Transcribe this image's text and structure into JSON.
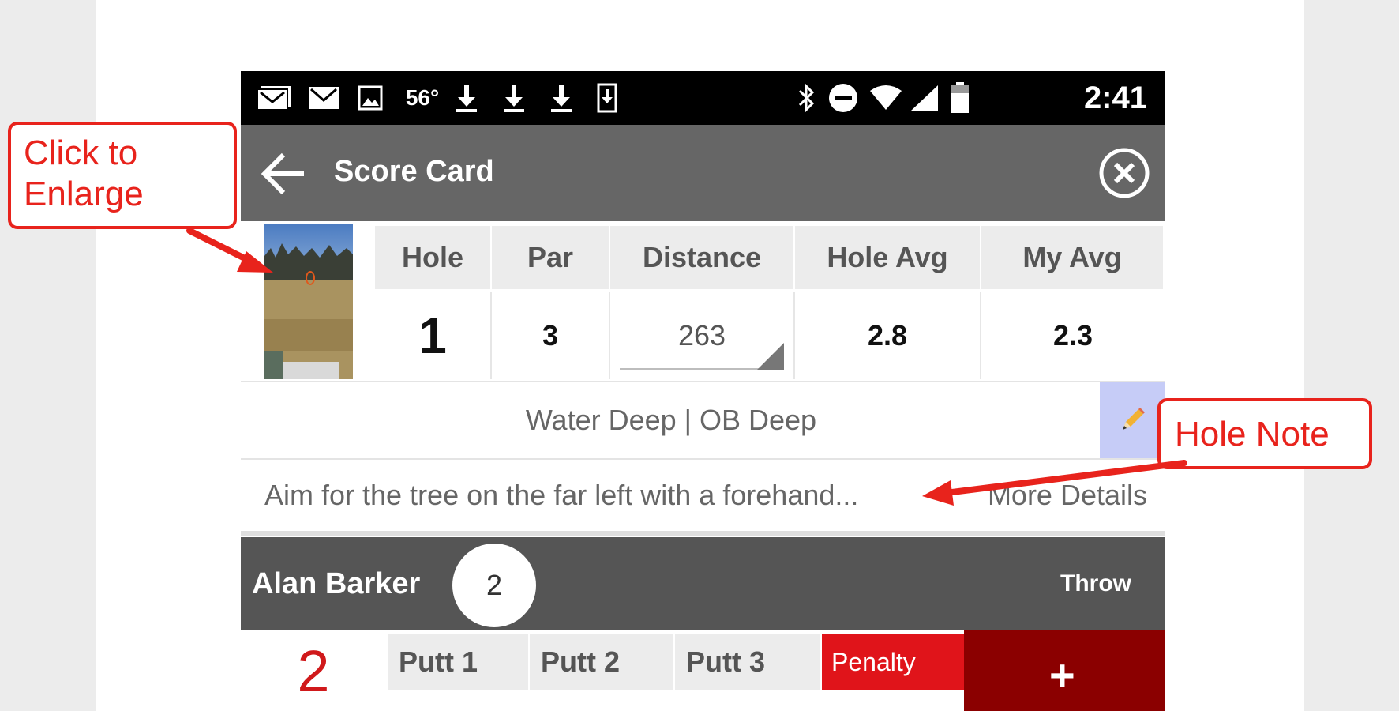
{
  "status_bar": {
    "temperature": "56°",
    "time": "2:41",
    "left_icons": [
      "gmail-multi-icon",
      "gmail-icon",
      "image-icon",
      "temperature",
      "download-icon",
      "download-icon",
      "download-icon",
      "phone-download-icon"
    ],
    "right_icons": [
      "bluetooth-icon",
      "do-not-disturb-icon",
      "wifi-icon",
      "cell-signal-icon",
      "battery-icon"
    ]
  },
  "app_bar": {
    "title": "Score Card"
  },
  "hole_table": {
    "headers": [
      "Hole",
      "Par",
      "Distance",
      "Hole Avg",
      "My Avg"
    ],
    "values": {
      "hole": "1",
      "par": "3",
      "distance": "263",
      "hole_avg": "2.8",
      "my_avg": "2.3"
    }
  },
  "hazards": "Water Deep | OB Deep",
  "note": {
    "text": "Aim for the tree on the far left with a forehand...",
    "more_label": "More Details"
  },
  "player": {
    "name": "Alan Barker",
    "score": "2",
    "throw_label": "Throw"
  },
  "strokes": {
    "big_score": "2",
    "putts": [
      "Putt 1",
      "Putt 2",
      "Putt 3"
    ],
    "penalty_label": "Penalty",
    "add_label": "+"
  },
  "annotations": {
    "enlarge": "Click to Enlarge",
    "hole_note": "Hole Note"
  },
  "colors": {
    "accent_red": "#e0141a",
    "dark_red": "#8b0000",
    "appbar_gray": "#666666",
    "callout_red": "#e8231c"
  }
}
